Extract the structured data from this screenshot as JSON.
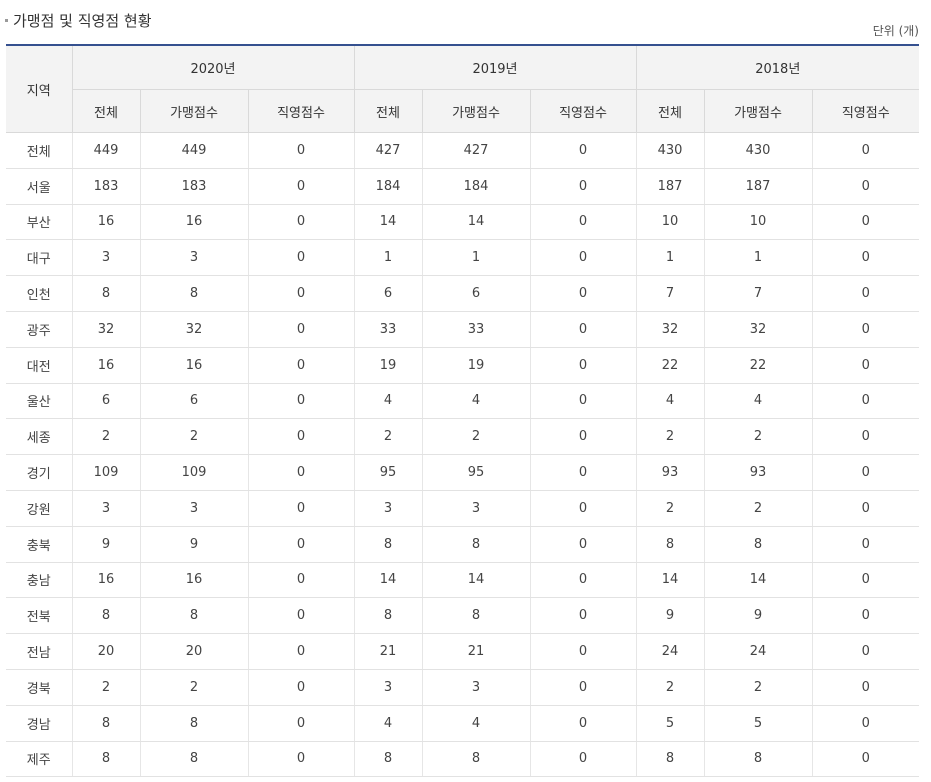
{
  "title": "가맹점 및 직영점 현황",
  "unit": "단위 (개)",
  "region_header": "지역",
  "years": [
    "2020년",
    "2019년",
    "2018년"
  ],
  "sub_headers": [
    "전체",
    "가맹점수",
    "직영점수"
  ],
  "rows": [
    {
      "region": "전체",
      "vals": [
        "449",
        "449",
        "0",
        "427",
        "427",
        "0",
        "430",
        "430",
        "0"
      ]
    },
    {
      "region": "서울",
      "vals": [
        "183",
        "183",
        "0",
        "184",
        "184",
        "0",
        "187",
        "187",
        "0"
      ]
    },
    {
      "region": "부산",
      "vals": [
        "16",
        "16",
        "0",
        "14",
        "14",
        "0",
        "10",
        "10",
        "0"
      ]
    },
    {
      "region": "대구",
      "vals": [
        "3",
        "3",
        "0",
        "1",
        "1",
        "0",
        "1",
        "1",
        "0"
      ]
    },
    {
      "region": "인천",
      "vals": [
        "8",
        "8",
        "0",
        "6",
        "6",
        "0",
        "7",
        "7",
        "0"
      ]
    },
    {
      "region": "광주",
      "vals": [
        "32",
        "32",
        "0",
        "33",
        "33",
        "0",
        "32",
        "32",
        "0"
      ]
    },
    {
      "region": "대전",
      "vals": [
        "16",
        "16",
        "0",
        "19",
        "19",
        "0",
        "22",
        "22",
        "0"
      ]
    },
    {
      "region": "울산",
      "vals": [
        "6",
        "6",
        "0",
        "4",
        "4",
        "0",
        "4",
        "4",
        "0"
      ]
    },
    {
      "region": "세종",
      "vals": [
        "2",
        "2",
        "0",
        "2",
        "2",
        "0",
        "2",
        "2",
        "0"
      ]
    },
    {
      "region": "경기",
      "vals": [
        "109",
        "109",
        "0",
        "95",
        "95",
        "0",
        "93",
        "93",
        "0"
      ]
    },
    {
      "region": "강원",
      "vals": [
        "3",
        "3",
        "0",
        "3",
        "3",
        "0",
        "2",
        "2",
        "0"
      ]
    },
    {
      "region": "충북",
      "vals": [
        "9",
        "9",
        "0",
        "8",
        "8",
        "0",
        "8",
        "8",
        "0"
      ]
    },
    {
      "region": "충남",
      "vals": [
        "16",
        "16",
        "0",
        "14",
        "14",
        "0",
        "14",
        "14",
        "0"
      ]
    },
    {
      "region": "전북",
      "vals": [
        "8",
        "8",
        "0",
        "8",
        "8",
        "0",
        "9",
        "9",
        "0"
      ]
    },
    {
      "region": "전남",
      "vals": [
        "20",
        "20",
        "0",
        "21",
        "21",
        "0",
        "24",
        "24",
        "0"
      ]
    },
    {
      "region": "경북",
      "vals": [
        "2",
        "2",
        "0",
        "3",
        "3",
        "0",
        "2",
        "2",
        "0"
      ]
    },
    {
      "region": "경남",
      "vals": [
        "8",
        "8",
        "0",
        "4",
        "4",
        "0",
        "5",
        "5",
        "0"
      ]
    },
    {
      "region": "제주",
      "vals": [
        "8",
        "8",
        "0",
        "8",
        "8",
        "0",
        "8",
        "8",
        "0"
      ]
    }
  ]
}
